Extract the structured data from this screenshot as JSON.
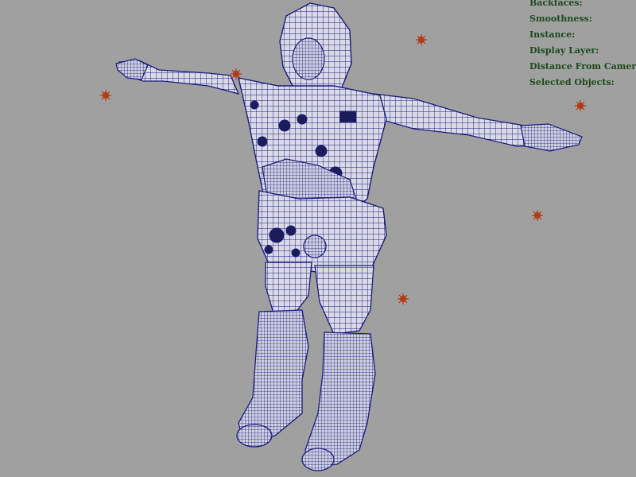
{
  "hud": {
    "backfaces": "Backfaces:",
    "smoothness": "Smoothness:",
    "instance": "Instance:",
    "display_layer": "Display Layer:",
    "distance_from_camera": "Distance From Camera:",
    "selected_objects": "Selected Objects:"
  },
  "colors": {
    "viewport_background": "#a0a0a0",
    "wireframe": "#1c1c7a",
    "hud_text": "#1d4a1d",
    "light_marker": "#c04a18"
  },
  "icons": {
    "light_marker": "point-light-icon"
  }
}
